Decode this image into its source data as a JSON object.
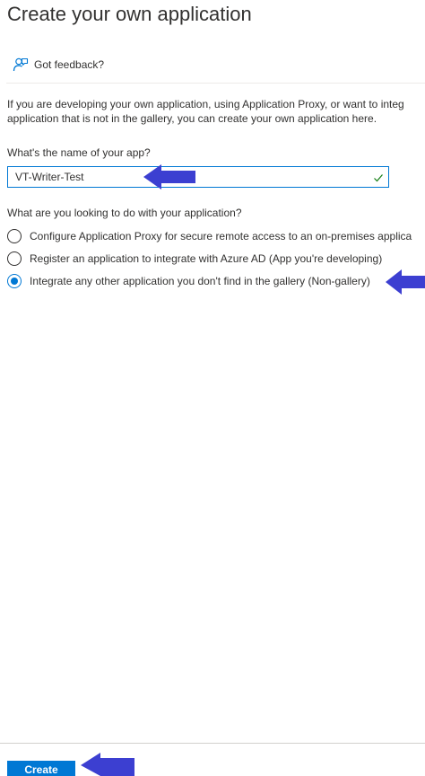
{
  "title": "Create your own application",
  "feedback": {
    "label": "Got feedback?",
    "icon": "person-feedback-icon"
  },
  "description": {
    "line1": "If you are developing your own application, using Application Proxy, or want to integ",
    "line2": "application that is not in the gallery, you can create your own application here."
  },
  "name_field": {
    "label": "What's the name of your app?",
    "value": "VT-Writer-Test",
    "valid_icon": "checkmark-icon"
  },
  "options": {
    "question": "What are you looking to do with your application?",
    "items": [
      {
        "label": "Configure Application Proxy for secure remote access to an on-premises applica",
        "selected": false
      },
      {
        "label": "Register an application to integrate with Azure AD (App you're developing)",
        "selected": false
      },
      {
        "label": "Integrate any other application you don't find in the gallery (Non-gallery)",
        "selected": true
      }
    ]
  },
  "footer": {
    "create_label": "Create"
  },
  "colors": {
    "accent": "#0078d4",
    "annotation_arrow": "#3c3fd1",
    "valid_check": "#107c10"
  }
}
